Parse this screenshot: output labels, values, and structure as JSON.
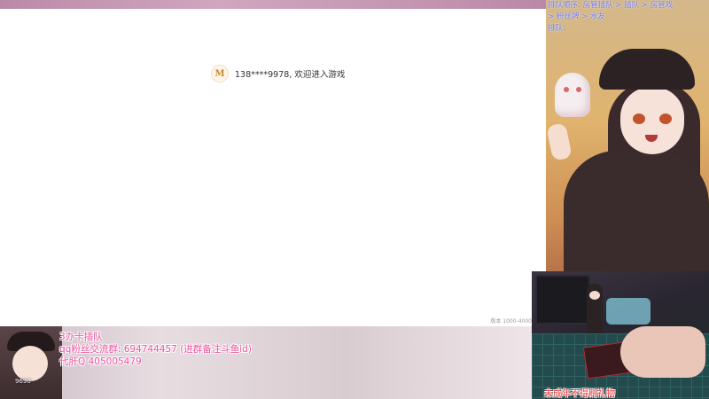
{
  "game": {
    "welcome_text": "138****9978, 欢迎进入游戏",
    "version_text": "版本 1000-4000"
  },
  "stream_overlay": {
    "queue_rules": [
      "排队顺序: 房管插队 > 插队 > 房管戏",
      "> 粉丝牌 > 水友",
      "排队:"
    ],
    "avatar_number": "9690",
    "info_lines": [
      "3办卡插队",
      "qq粉丝交流群: 694744457 (进群备注斗鱼id)",
      "代肝Q 405005479"
    ],
    "warning": "未成年不得刷礼物"
  },
  "colors": {
    "info_pink": "#f0509e",
    "rules_blue": "#6f7cf0",
    "warning_red": "#ff3d3d"
  }
}
